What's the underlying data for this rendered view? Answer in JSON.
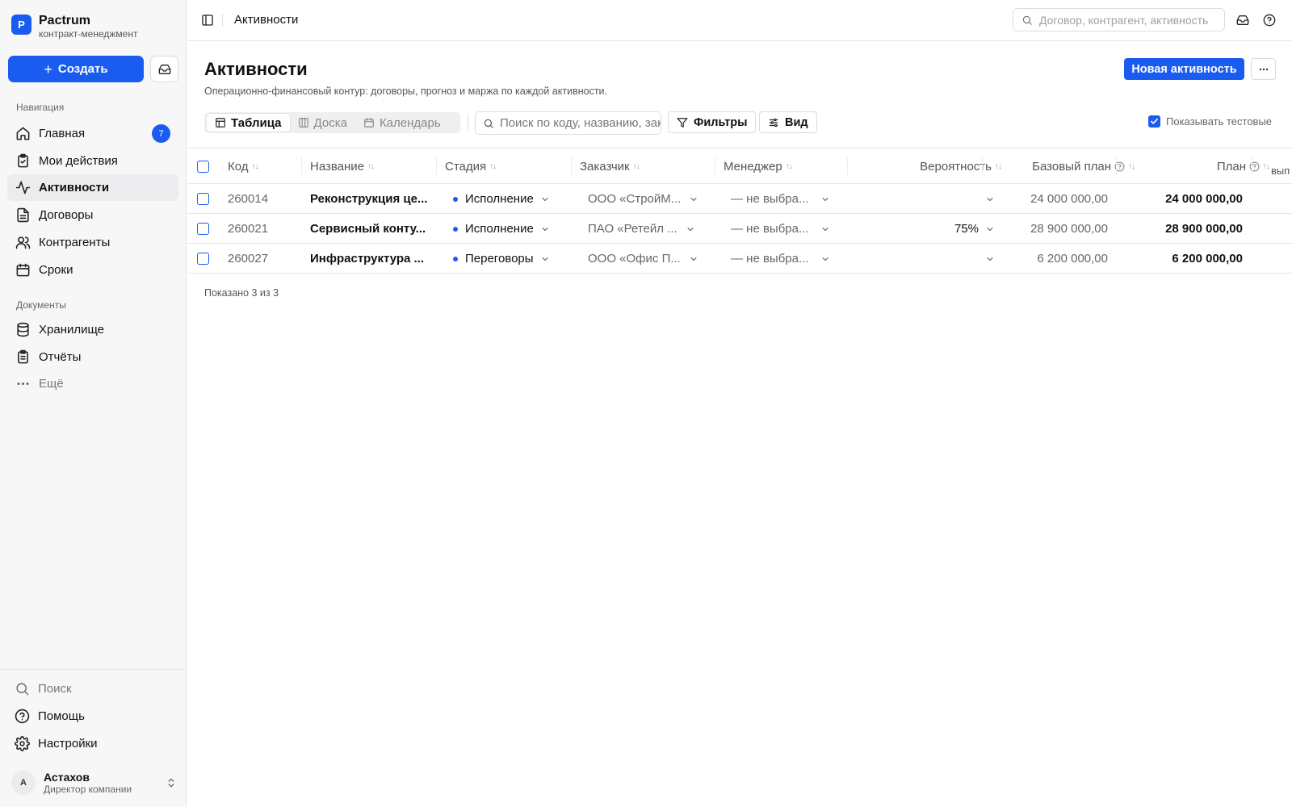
{
  "brand": {
    "logo_letter": "P",
    "name": "Pactrum",
    "subtitle": "контракт-менеджмент"
  },
  "sidebar": {
    "create_label": "Создать",
    "nav_section": "Навигация",
    "items": [
      {
        "label": "Главная",
        "icon": "home-icon",
        "badge": "7"
      },
      {
        "label": "Мои действия",
        "icon": "clipboard-check-icon"
      },
      {
        "label": "Активности",
        "icon": "activity-icon",
        "active": true
      },
      {
        "label": "Договоры",
        "icon": "file-text-icon"
      },
      {
        "label": "Контрагенты",
        "icon": "users-icon"
      },
      {
        "label": "Сроки",
        "icon": "calendar-icon"
      }
    ],
    "docs_section": "Документы",
    "doc_items": [
      {
        "label": "Хранилище",
        "icon": "database-icon"
      },
      {
        "label": "Отчёты",
        "icon": "clipboard-list-icon"
      },
      {
        "label": "Ещё",
        "icon": "more-horizontal-icon"
      }
    ],
    "bottom_items": [
      {
        "label": "Поиск",
        "icon": "search-icon"
      },
      {
        "label": "Помощь",
        "icon": "help-circle-icon"
      },
      {
        "label": "Настройки",
        "icon": "gear-icon"
      }
    ],
    "user": {
      "initial": "А",
      "name": "Астахов",
      "role": "Директор компании"
    }
  },
  "topbar": {
    "title": "Активности",
    "search_placeholder": "Договор, контрагент, активность"
  },
  "page": {
    "title": "Активности",
    "subtitle": "Операционно-финансовый контур: договоры, прогноз и маржа по каждой активности.",
    "new_button": "Новая активность",
    "views": [
      {
        "label": "Таблица",
        "icon": "table-icon",
        "active": true
      },
      {
        "label": "Доска",
        "icon": "columns-icon"
      },
      {
        "label": "Календарь",
        "icon": "calendar-icon"
      }
    ],
    "search_placeholder": "Поиск по коду, названию, заказчику",
    "filters_label": "Фильтры",
    "view_label": "Вид",
    "show_test_label": "Показывать тестовые",
    "show_test_checked": true
  },
  "table": {
    "columns": {
      "code": "Код",
      "name": "Название",
      "stage": "Стадия",
      "customer": "Заказчик",
      "manager": "Менеджер",
      "probability": "Вероятность",
      "base_plan": "Базовый план",
      "plan": "План",
      "cut": "вып"
    },
    "rows": [
      {
        "code": "260014",
        "name": "Реконструкция це...",
        "stage": "Исполнение",
        "customer": "ООО «СтройМ...",
        "manager": "— не выбра...",
        "probability": "",
        "base_plan": "24 000 000,00",
        "plan": "24 000 000,00"
      },
      {
        "code": "260021",
        "name": "Сервисный конту...",
        "stage": "Исполнение",
        "customer": "ПАО «Ретейл ...",
        "manager": "— не выбра...",
        "probability": "75%",
        "base_plan": "28 900 000,00",
        "plan": "28 900 000,00"
      },
      {
        "code": "260027",
        "name": "Инфраструктура ...",
        "stage": "Переговоры",
        "customer": "ООО «Офис П...",
        "manager": "— не выбра...",
        "probability": "",
        "base_plan": "6 200 000,00",
        "plan": "6 200 000,00"
      }
    ],
    "footer": "Показано 3 из 3"
  },
  "colors": {
    "accent": "#1a5cf0",
    "border": "#e5e5e7",
    "sidebar_bg": "#f7f7f8"
  }
}
